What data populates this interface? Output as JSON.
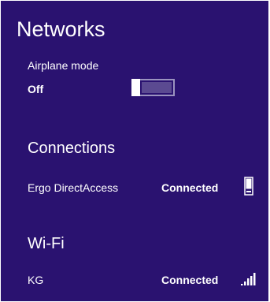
{
  "panel": {
    "title": "Networks",
    "background": "#2a1270"
  },
  "airplane": {
    "label": "Airplane mode",
    "state": "Off",
    "enabled": false
  },
  "connections": {
    "heading": "Connections",
    "items": [
      {
        "name": "Ergo DirectAccess",
        "status": "Connected",
        "icon": "device-icon"
      }
    ]
  },
  "wifi": {
    "heading": "Wi-Fi",
    "items": [
      {
        "name": "KG",
        "status": "Connected",
        "icon": "signal-strength-icon",
        "signal_level": 1.0
      }
    ]
  }
}
